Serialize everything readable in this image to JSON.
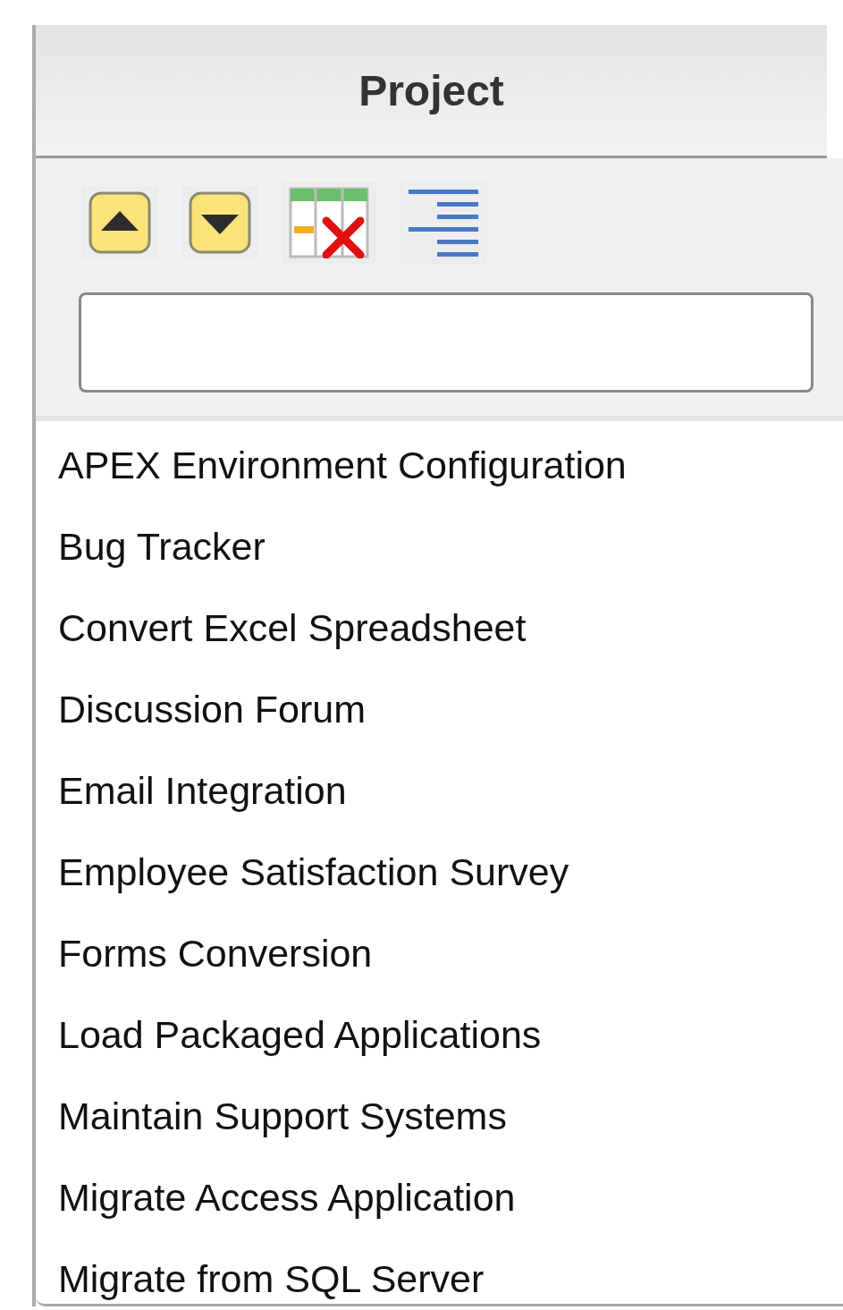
{
  "header": {
    "title": "Project"
  },
  "toolbar": {
    "buttons": [
      {
        "kind": "up"
      },
      {
        "kind": "down"
      },
      {
        "kind": "remove"
      },
      {
        "kind": "aggregate"
      }
    ]
  },
  "items": [
    "APEX Environment Configuration",
    "Bug Tracker",
    "Convert Excel Spreadsheet",
    "Discussion Forum",
    "Email Integration",
    "Employee Satisfaction Survey",
    "Forms Conversion",
    "Load Packaged Applications",
    "Maintain Support Systems",
    "Migrate Access Application",
    "Migrate from SQL Server"
  ]
}
